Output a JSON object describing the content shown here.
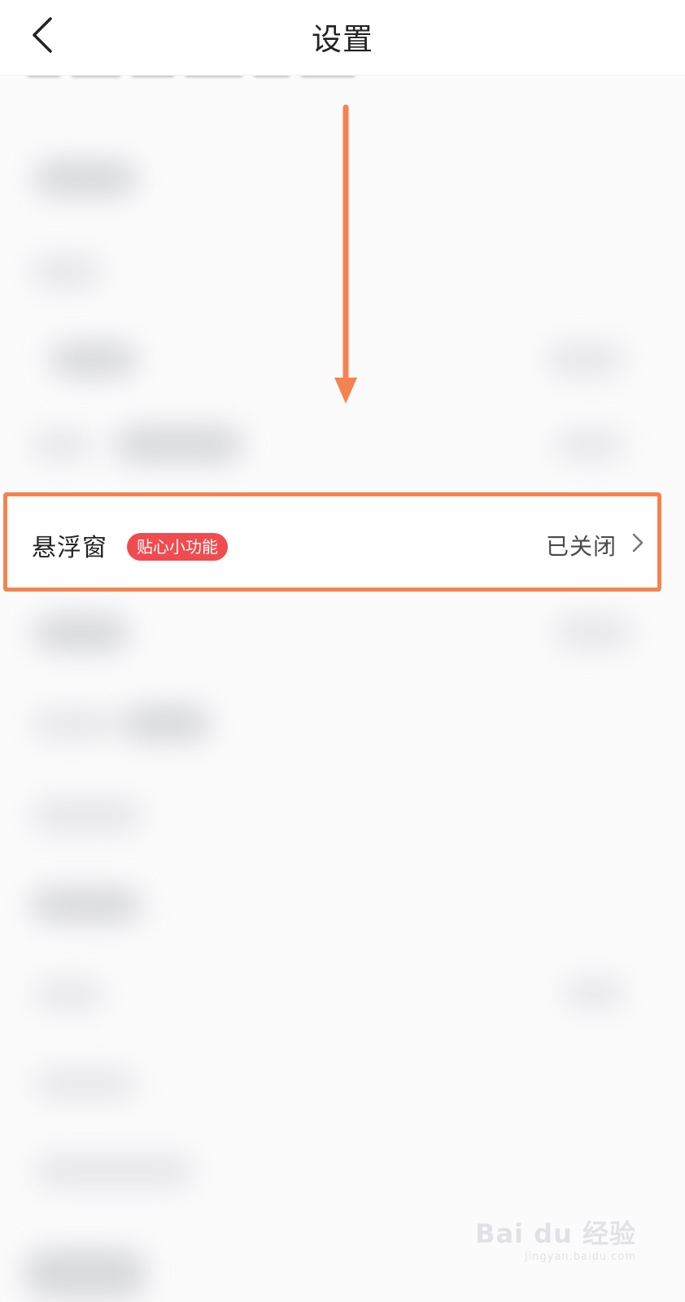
{
  "header": {
    "title": "设置"
  },
  "floating_window_row": {
    "label": "悬浮窗",
    "badge": "贴心小功能",
    "status": "已关闭"
  },
  "annotation": {
    "arrow_color": "#f5834f",
    "highlight_color": "#f5834f"
  },
  "watermark": {
    "logo": "Bai du 经验",
    "url": "jingyan.baidu.com"
  }
}
